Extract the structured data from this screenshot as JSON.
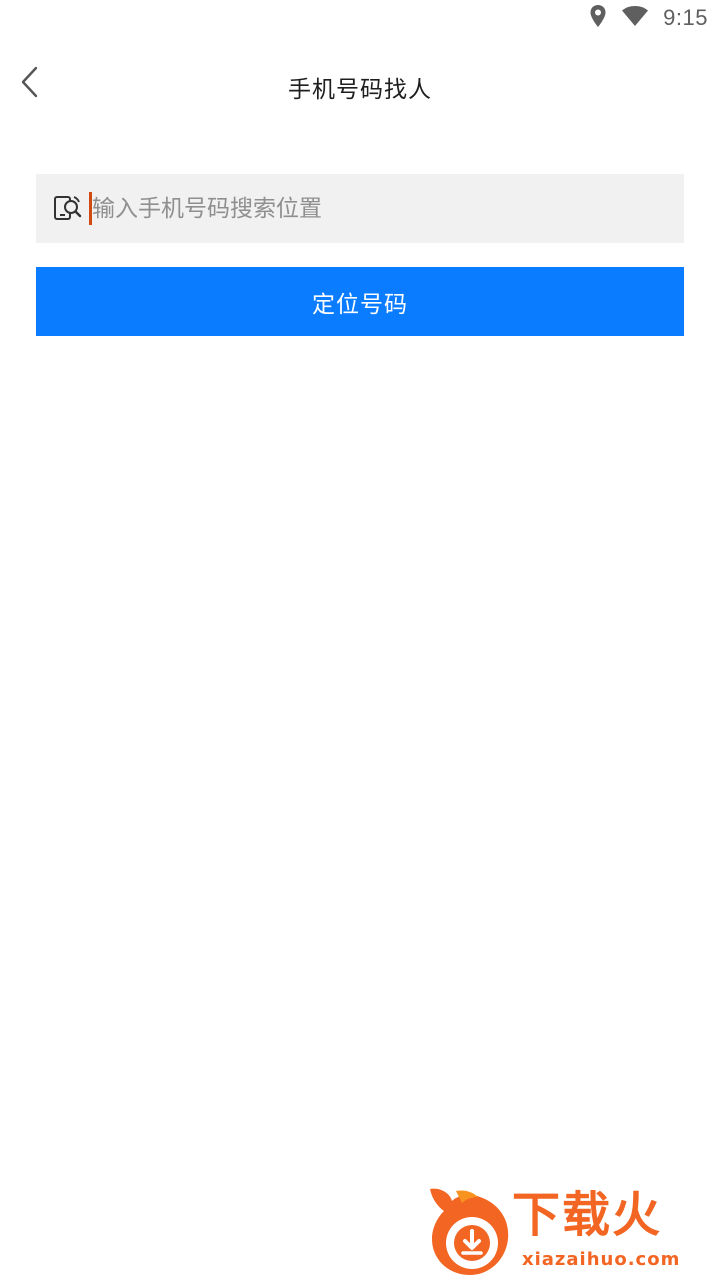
{
  "status_bar": {
    "time": "9:15",
    "icons": [
      "location-icon",
      "wifi-icon"
    ]
  },
  "header": {
    "title": "手机号码找人",
    "back_icon": "chevron-left-icon"
  },
  "search": {
    "value": "",
    "placeholder": "输入手机号码搜索位置",
    "icon": "phone-search-icon"
  },
  "actions": {
    "locate_label": "定位号码"
  },
  "watermark": {
    "title": "下载火",
    "url": "xiazaihuo.com"
  },
  "colors": {
    "primary": "#0a7cff",
    "input_background": "#f1f1f1",
    "caret": "#d04a12",
    "watermark": "#f26522"
  }
}
